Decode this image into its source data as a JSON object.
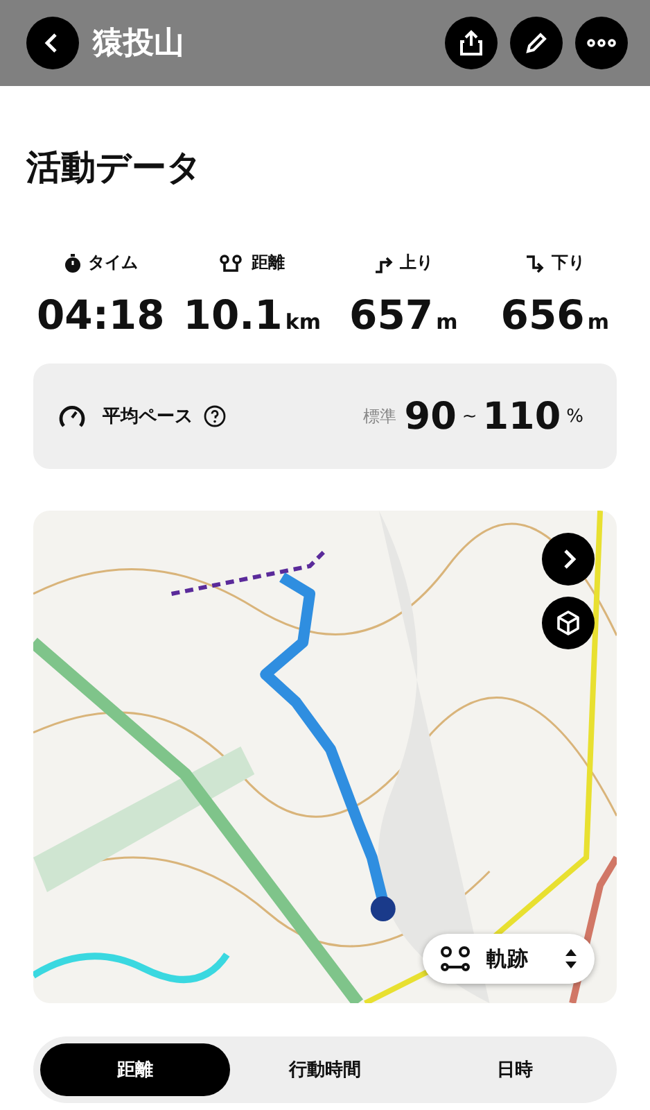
{
  "header": {
    "title": "猿投山"
  },
  "section_title": "活動データ",
  "stats": [
    {
      "kind": "time",
      "label": "タイム",
      "value": "04:18"
    },
    {
      "kind": "distance",
      "label": "距離",
      "value": "10.1",
      "unit": "km"
    },
    {
      "kind": "ascent",
      "label": "上り",
      "value": "657",
      "unit": "m"
    },
    {
      "kind": "descent",
      "label": "下り",
      "value": "656",
      "unit": "m"
    }
  ],
  "pace": {
    "label": "平均ペース",
    "grade": "標準",
    "low": "90",
    "sep": "~",
    "high": "110",
    "unit": "%"
  },
  "map": {
    "kind": "picture",
    "layer_selector": "軌跡"
  },
  "tabs": [
    {
      "label": "距離",
      "selected": true
    },
    {
      "label": "行動時間",
      "selected": false
    },
    {
      "label": "日時",
      "selected": false
    }
  ]
}
